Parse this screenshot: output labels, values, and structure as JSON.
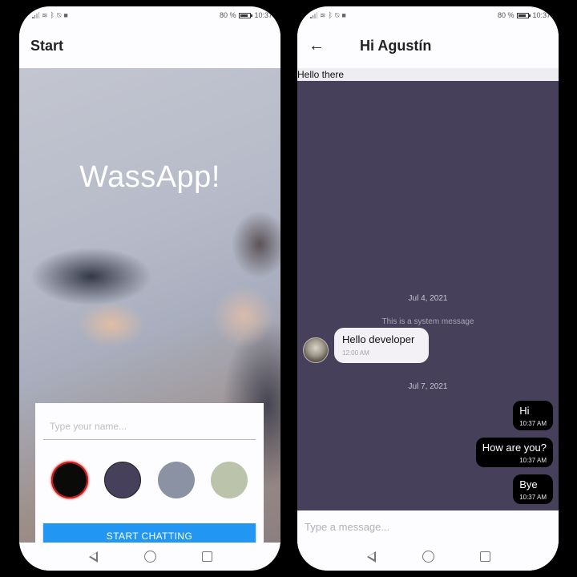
{
  "status_bar": {
    "battery_percent": "80 %",
    "time": "10:37",
    "icons": [
      "signal-icon",
      "wifi-icon",
      "bluetooth-icon",
      "bell-off-icon",
      "video-icon",
      "battery-icon"
    ]
  },
  "start_screen": {
    "app_bar_title": "Start",
    "hero_title": "WassApp!",
    "name_input": {
      "value": "",
      "placeholder": "Type your name..."
    },
    "color_options": [
      {
        "name": "black",
        "color": "#0a0b08",
        "selected": true
      },
      {
        "name": "dark-purple",
        "color": "#47405a",
        "selected": false
      },
      {
        "name": "slate-gray",
        "color": "#8a92a3",
        "selected": false
      },
      {
        "name": "sage-green",
        "color": "#bbc4aa",
        "selected": false
      }
    ],
    "start_button_label": "START CHATTING",
    "accent_color": "#2196f3"
  },
  "chat_screen": {
    "app_bar_title": "Hi Agustín",
    "banner_text": "Hello there",
    "chat_background": "#47405a",
    "messages": [
      {
        "type": "date",
        "text": "Jul 4, 2021"
      },
      {
        "type": "system",
        "text": "This is a system message"
      },
      {
        "type": "incoming",
        "text": "Hello developer",
        "time": "12:00 AM"
      },
      {
        "type": "date",
        "text": "Jul 7, 2021"
      },
      {
        "type": "outgoing",
        "text": "Hi",
        "time": "10:37 AM"
      },
      {
        "type": "outgoing",
        "text": "How are you?",
        "time": "10:37 AM"
      },
      {
        "type": "outgoing",
        "text": "Bye",
        "time": "10:37 AM"
      }
    ],
    "compose": {
      "value": "",
      "placeholder": "Type a message..."
    }
  },
  "nav_bar": {
    "buttons": [
      "back",
      "home",
      "recents"
    ]
  }
}
